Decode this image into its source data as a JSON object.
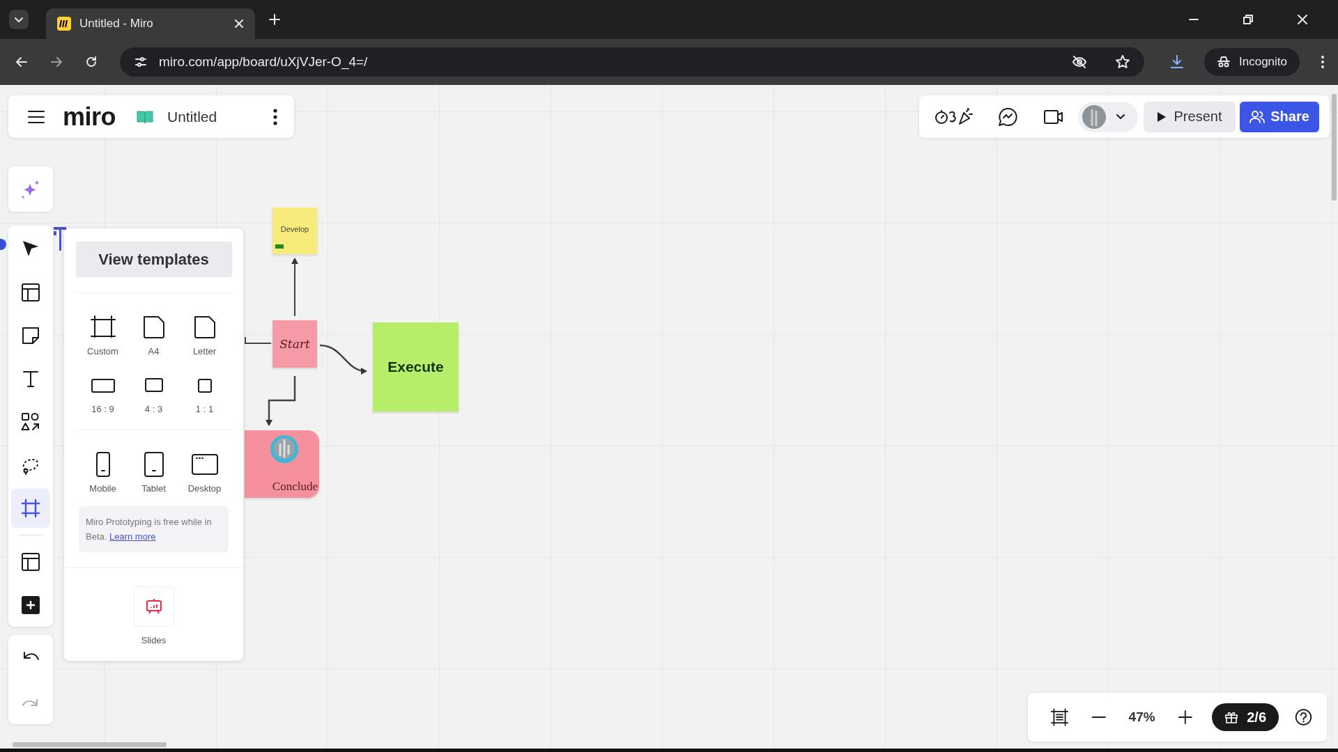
{
  "browser": {
    "tab": {
      "title": "Untitled - Miro"
    },
    "address": {
      "url": "miro.com/app/board/uXjVJer-O_4=/"
    },
    "profile": {
      "label": "Incognito"
    }
  },
  "board_header": {
    "logo": "miro",
    "title": "Untitled"
  },
  "toolbar": {
    "tools": [
      {
        "selected": false
      },
      {
        "selected": false
      },
      {
        "selected": false
      },
      {
        "selected": false
      },
      {
        "selected": false
      },
      {
        "selected": false
      },
      {
        "selected": true
      },
      {
        "selected": false
      },
      {
        "selected": false
      }
    ]
  },
  "frame_panel": {
    "button": "View templates",
    "groups": [
      [
        {
          "label": "Custom"
        },
        {
          "label": "A4"
        },
        {
          "label": "Letter"
        },
        {
          "label": "16 : 9"
        },
        {
          "label": "4 : 3"
        },
        {
          "label": "1 : 1"
        }
      ],
      [
        {
          "label": "Mobile"
        },
        {
          "label": "Tablet"
        },
        {
          "label": "Desktop"
        }
      ]
    ],
    "note": {
      "text": "Miro Prototyping is free while in Beta.",
      "link": "Learn more"
    },
    "slides": {
      "label": "Slides"
    }
  },
  "canvas": {
    "notes": [
      {
        "text": "Develop",
        "kind": "sticky",
        "color": "#f7ec7a",
        "has_tag": true
      },
      {
        "text": "Start",
        "kind": "sticky",
        "color": "#f59aa6",
        "has_tag": false
      },
      {
        "text": "Execute",
        "kind": "sticky",
        "color": "#b8ef6a",
        "has_tag": false
      },
      {
        "text": "Conclude",
        "kind": "shape",
        "color": "#f4919d",
        "has_tag": false
      }
    ]
  },
  "top_bar": {
    "present": "Present",
    "share": "Share"
  },
  "zoom_bar": {
    "zoom": "47%",
    "gifts": "2/6"
  }
}
